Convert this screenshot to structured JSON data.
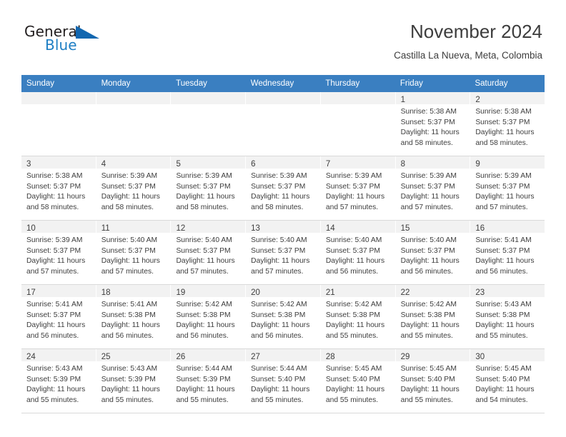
{
  "brand": {
    "word_one": "General",
    "word_two": "Blue",
    "triangle_icon": "blue-triangle-logo-icon",
    "accent_color": "#1267b0"
  },
  "header": {
    "title": "November 2024",
    "subtitle": "Castilla La Nueva, Meta, Colombia"
  },
  "calendar": {
    "header_bg": "#3a7fc1",
    "daynum_bg": "#f2f2f2",
    "weekday_headers": [
      "Sunday",
      "Monday",
      "Tuesday",
      "Wednesday",
      "Thursday",
      "Friday",
      "Saturday"
    ],
    "weeks": [
      [
        {
          "day": "",
          "lines": []
        },
        {
          "day": "",
          "lines": []
        },
        {
          "day": "",
          "lines": []
        },
        {
          "day": "",
          "lines": []
        },
        {
          "day": "",
          "lines": []
        },
        {
          "day": "1",
          "lines": [
            "Sunrise: 5:38 AM",
            "Sunset: 5:37 PM",
            "Daylight: 11 hours",
            "and 58 minutes."
          ]
        },
        {
          "day": "2",
          "lines": [
            "Sunrise: 5:38 AM",
            "Sunset: 5:37 PM",
            "Daylight: 11 hours",
            "and 58 minutes."
          ]
        }
      ],
      [
        {
          "day": "3",
          "lines": [
            "Sunrise: 5:38 AM",
            "Sunset: 5:37 PM",
            "Daylight: 11 hours",
            "and 58 minutes."
          ]
        },
        {
          "day": "4",
          "lines": [
            "Sunrise: 5:39 AM",
            "Sunset: 5:37 PM",
            "Daylight: 11 hours",
            "and 58 minutes."
          ]
        },
        {
          "day": "5",
          "lines": [
            "Sunrise: 5:39 AM",
            "Sunset: 5:37 PM",
            "Daylight: 11 hours",
            "and 58 minutes."
          ]
        },
        {
          "day": "6",
          "lines": [
            "Sunrise: 5:39 AM",
            "Sunset: 5:37 PM",
            "Daylight: 11 hours",
            "and 58 minutes."
          ]
        },
        {
          "day": "7",
          "lines": [
            "Sunrise: 5:39 AM",
            "Sunset: 5:37 PM",
            "Daylight: 11 hours",
            "and 57 minutes."
          ]
        },
        {
          "day": "8",
          "lines": [
            "Sunrise: 5:39 AM",
            "Sunset: 5:37 PM",
            "Daylight: 11 hours",
            "and 57 minutes."
          ]
        },
        {
          "day": "9",
          "lines": [
            "Sunrise: 5:39 AM",
            "Sunset: 5:37 PM",
            "Daylight: 11 hours",
            "and 57 minutes."
          ]
        }
      ],
      [
        {
          "day": "10",
          "lines": [
            "Sunrise: 5:39 AM",
            "Sunset: 5:37 PM",
            "Daylight: 11 hours",
            "and 57 minutes."
          ]
        },
        {
          "day": "11",
          "lines": [
            "Sunrise: 5:40 AM",
            "Sunset: 5:37 PM",
            "Daylight: 11 hours",
            "and 57 minutes."
          ]
        },
        {
          "day": "12",
          "lines": [
            "Sunrise: 5:40 AM",
            "Sunset: 5:37 PM",
            "Daylight: 11 hours",
            "and 57 minutes."
          ]
        },
        {
          "day": "13",
          "lines": [
            "Sunrise: 5:40 AM",
            "Sunset: 5:37 PM",
            "Daylight: 11 hours",
            "and 57 minutes."
          ]
        },
        {
          "day": "14",
          "lines": [
            "Sunrise: 5:40 AM",
            "Sunset: 5:37 PM",
            "Daylight: 11 hours",
            "and 56 minutes."
          ]
        },
        {
          "day": "15",
          "lines": [
            "Sunrise: 5:40 AM",
            "Sunset: 5:37 PM",
            "Daylight: 11 hours",
            "and 56 minutes."
          ]
        },
        {
          "day": "16",
          "lines": [
            "Sunrise: 5:41 AM",
            "Sunset: 5:37 PM",
            "Daylight: 11 hours",
            "and 56 minutes."
          ]
        }
      ],
      [
        {
          "day": "17",
          "lines": [
            "Sunrise: 5:41 AM",
            "Sunset: 5:37 PM",
            "Daylight: 11 hours",
            "and 56 minutes."
          ]
        },
        {
          "day": "18",
          "lines": [
            "Sunrise: 5:41 AM",
            "Sunset: 5:38 PM",
            "Daylight: 11 hours",
            "and 56 minutes."
          ]
        },
        {
          "day": "19",
          "lines": [
            "Sunrise: 5:42 AM",
            "Sunset: 5:38 PM",
            "Daylight: 11 hours",
            "and 56 minutes."
          ]
        },
        {
          "day": "20",
          "lines": [
            "Sunrise: 5:42 AM",
            "Sunset: 5:38 PM",
            "Daylight: 11 hours",
            "and 56 minutes."
          ]
        },
        {
          "day": "21",
          "lines": [
            "Sunrise: 5:42 AM",
            "Sunset: 5:38 PM",
            "Daylight: 11 hours",
            "and 55 minutes."
          ]
        },
        {
          "day": "22",
          "lines": [
            "Sunrise: 5:42 AM",
            "Sunset: 5:38 PM",
            "Daylight: 11 hours",
            "and 55 minutes."
          ]
        },
        {
          "day": "23",
          "lines": [
            "Sunrise: 5:43 AM",
            "Sunset: 5:38 PM",
            "Daylight: 11 hours",
            "and 55 minutes."
          ]
        }
      ],
      [
        {
          "day": "24",
          "lines": [
            "Sunrise: 5:43 AM",
            "Sunset: 5:39 PM",
            "Daylight: 11 hours",
            "and 55 minutes."
          ]
        },
        {
          "day": "25",
          "lines": [
            "Sunrise: 5:43 AM",
            "Sunset: 5:39 PM",
            "Daylight: 11 hours",
            "and 55 minutes."
          ]
        },
        {
          "day": "26",
          "lines": [
            "Sunrise: 5:44 AM",
            "Sunset: 5:39 PM",
            "Daylight: 11 hours",
            "and 55 minutes."
          ]
        },
        {
          "day": "27",
          "lines": [
            "Sunrise: 5:44 AM",
            "Sunset: 5:40 PM",
            "Daylight: 11 hours",
            "and 55 minutes."
          ]
        },
        {
          "day": "28",
          "lines": [
            "Sunrise: 5:45 AM",
            "Sunset: 5:40 PM",
            "Daylight: 11 hours",
            "and 55 minutes."
          ]
        },
        {
          "day": "29",
          "lines": [
            "Sunrise: 5:45 AM",
            "Sunset: 5:40 PM",
            "Daylight: 11 hours",
            "and 55 minutes."
          ]
        },
        {
          "day": "30",
          "lines": [
            "Sunrise: 5:45 AM",
            "Sunset: 5:40 PM",
            "Daylight: 11 hours",
            "and 54 minutes."
          ]
        }
      ]
    ]
  }
}
